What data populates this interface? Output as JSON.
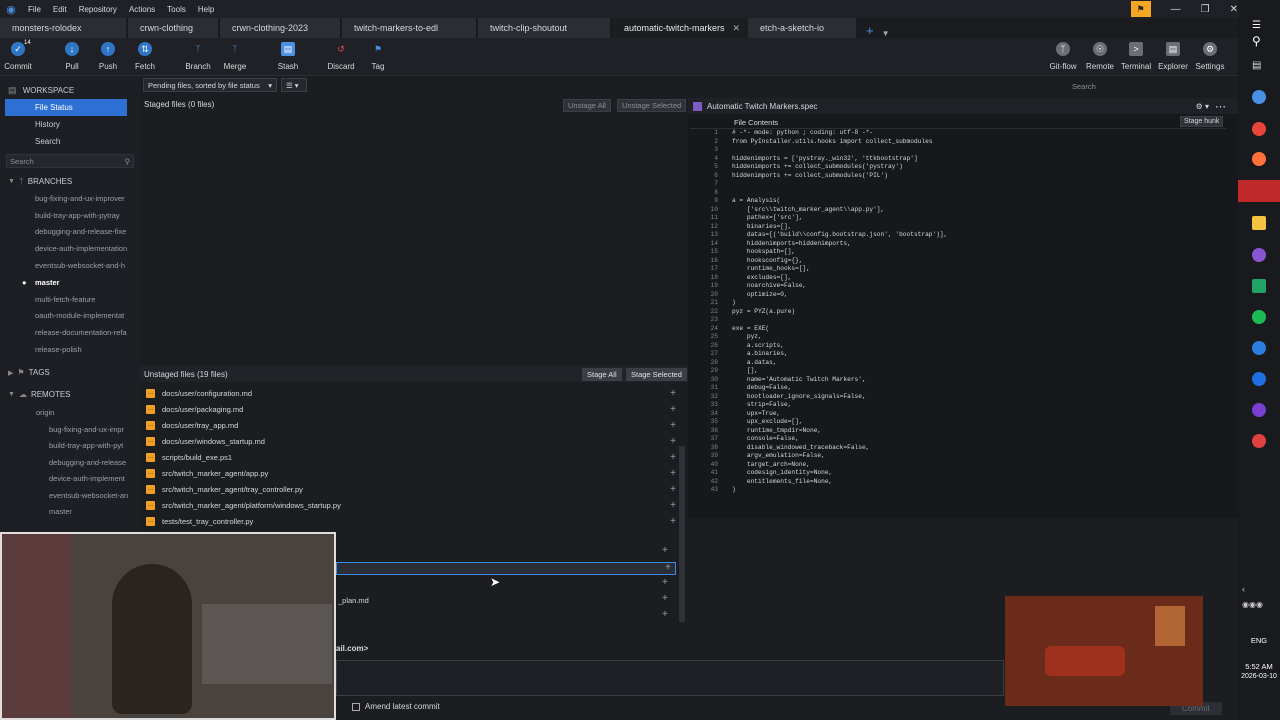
{
  "menu": {
    "items": [
      "File",
      "Edit",
      "Repository",
      "Actions",
      "Tools",
      "Help"
    ]
  },
  "tabs": [
    {
      "label": "monsters-rolodex"
    },
    {
      "label": "crwn-clothing"
    },
    {
      "label": "crwn-clothing-2023"
    },
    {
      "label": "twitch-markers-to-edl"
    },
    {
      "label": "twitch-clip-shoutout"
    },
    {
      "label": "automatic-twitch-markers",
      "active": true
    },
    {
      "label": "etch-a-sketch-io"
    }
  ],
  "toolbar": {
    "commit": "Commit",
    "commit_badge": "14",
    "pull": "Pull",
    "push": "Push",
    "fetch": "Fetch",
    "branch": "Branch",
    "merge": "Merge",
    "stash": "Stash",
    "discard": "Discard",
    "tag": "Tag",
    "gitflow": "Git-flow",
    "remote": "Remote",
    "terminal": "Terminal",
    "explorer": "Explorer",
    "settings": "Settings",
    "search_placeholder": "Search"
  },
  "sidebar": {
    "workspace": "WORKSPACE",
    "file_status": "File Status",
    "history": "History",
    "search": "Search",
    "search_placeholder": "Search",
    "branches_label": "BRANCHES",
    "branches": [
      "bug-fixing-and-ux-improver",
      "build-tray-app-with-pytray",
      "debugging-and-release-fixe",
      "device-auth-implementation",
      "eventsub-websocket-and-h",
      "master",
      "multi-fetch-feature",
      "oauth-module-implementat",
      "release-documentation-refa",
      "release-polish"
    ],
    "current_branch": "master",
    "tags_label": "TAGS",
    "remotes_label": "REMOTES",
    "origin": "origin",
    "remote_branches": [
      "bug-fixing-and-ux-impr",
      "build-tray-app-with-pyt",
      "debugging-and-release",
      "device-auth-implement",
      "eventsub-websocket-an",
      "master"
    ]
  },
  "staged": {
    "filter": "Pending files, sorted by file status",
    "title": "Staged files",
    "count": "(0 files)",
    "unstage_all": "Unstage All",
    "unstage_selected": "Unstage Selected"
  },
  "unstaged": {
    "title": "Unstaged files",
    "count": "(19 files)",
    "stage_all": "Stage All",
    "stage_selected": "Stage Selected",
    "files": [
      "docs/user/configuration.md",
      "docs/user/packaging.md",
      "docs/user/tray_app.md",
      "docs/user/windows_startup.md",
      "scripts/build_exe.ps1",
      "src/twitch_marker_agent/app.py",
      "src/twitch_marker_agent/tray_controller.py",
      "src/twitch_marker_agent/platform/windows_startup.py",
      "tests/test_tray_controller.py"
    ],
    "partial_file": "_plan.md"
  },
  "editor": {
    "file": "Automatic Twitch Markers.spec",
    "section": "File Contents",
    "stage_hunk": "Stage hunk",
    "lines": [
      "# -*- mode: python ; coding: utf-8 -*-",
      "from PyInstaller.utils.hooks import collect_submodules",
      "",
      "hiddenimports = ['pystray._win32', 'ttkbootstrap']",
      "hiddenimports += collect_submodules('pystray')",
      "hiddenimports += collect_submodules('PIL')",
      "",
      "",
      "a = Analysis(",
      "    ['src\\\\twitch_marker_agent\\\\app.py'],",
      "    pathex=['src'],",
      "    binaries=[],",
      "    datas=[('build\\\\config.bootstrap.json', 'bootstrap')],",
      "    hiddenimports=hiddenimports,",
      "    hookspath=[],",
      "    hooksconfig={},",
      "    runtime_hooks=[],",
      "    excludes=[],",
      "    noarchive=False,",
      "    optimize=0,",
      ")",
      "pyz = PYZ(a.pure)",
      "",
      "exe = EXE(",
      "    pyz,",
      "    a.scripts,",
      "    a.binaries,",
      "    a.datas,",
      "    [],",
      "    name='Automatic Twitch Markers',",
      "    debug=False,",
      "    bootloader_ignore_signals=False,",
      "    strip=False,",
      "    upx=True,",
      "    upx_exclude=[],",
      "    runtime_tmpdir=None,",
      "    console=False,",
      "    disable_windowed_traceback=False,",
      "    argv_emulation=False,",
      "    target_arch=None,",
      "    codesign_identity=None,",
      "    entitlements_file=None,",
      ")"
    ]
  },
  "commit": {
    "author": "ail.com>",
    "amend": "Amend latest commit",
    "commit_btn": "Commit"
  },
  "taskbar": {
    "lang": "ENG",
    "time": "5:52 AM",
    "date": "2026-03-10"
  }
}
